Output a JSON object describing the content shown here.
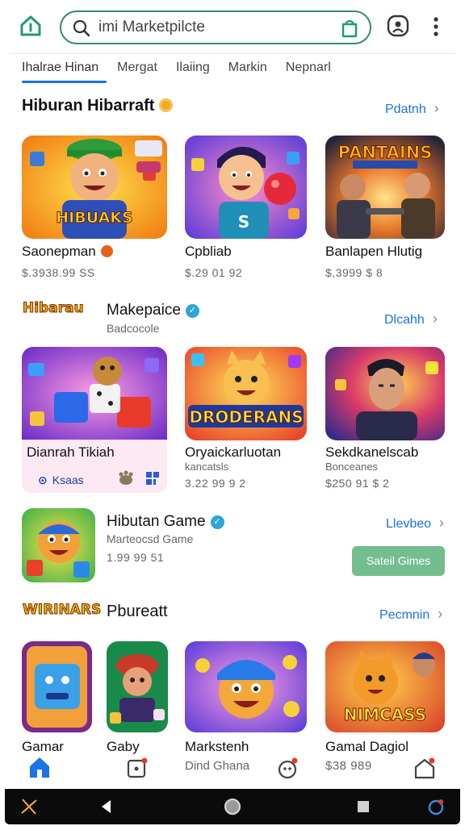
{
  "search": {
    "placeholder": "imi Marketpilcte"
  },
  "tabs": [
    {
      "label": "Ihalrae Hinan",
      "active": true
    },
    {
      "label": "Mergat",
      "active": false
    },
    {
      "label": "Ilaiing",
      "active": false
    },
    {
      "label": "Markin",
      "active": false
    },
    {
      "label": "Nepnarl",
      "active": false
    }
  ],
  "section1": {
    "title": "Hiburan Hibarraft",
    "see_all": "Pdatnh",
    "cards": [
      {
        "name": "Saonepman",
        "price": "$.3938.99 SS",
        "thumb_text": "HIBUAKS"
      },
      {
        "name": "Cpbliab",
        "price": "$.29 01 92"
      },
      {
        "name": "Banlapen Hlutig",
        "price": "$,3999 $ 8",
        "thumb_text": "PANTAINS"
      }
    ]
  },
  "section2": {
    "logo_text": "Hibarau",
    "title": "Makepaice",
    "subtitle": "Badcocole",
    "see_all": "Dlcahh",
    "cards": [
      {
        "name": "Dianrah Tikiah",
        "highlight_label": "Ksaas"
      },
      {
        "name": "Oryaickarluotan",
        "subtitle": "kancatsls",
        "price": "3.22 99 9 2",
        "thumb_text": "DRODERANS"
      },
      {
        "name": "Sekdkanelscab",
        "subtitle": "Bonceanes",
        "price": "$250 91 $ 2"
      }
    ]
  },
  "section3": {
    "title": "Hibutan Game",
    "subtitle": "Marteocsd Game",
    "price": "1.99 99 51",
    "see_all": "Llevbeo",
    "install": "Sateil Gimes"
  },
  "section4": {
    "logo_text": "WIRINARS",
    "title": "Pbureatt",
    "see_all": "Pecmnin",
    "cards": [
      {
        "name": "Gamar"
      },
      {
        "name": "Gaby"
      },
      {
        "name": "Markstenh",
        "subtitle": "Dind Ghana"
      },
      {
        "name": "Gamal Dagiol",
        "price": "$38 989",
        "thumb_text": "NIMCASS"
      }
    ]
  },
  "colors": {
    "accent": "#1a73e8",
    "search_border": "#2f8f6a",
    "install": "#74bd8e"
  },
  "icons": [
    "home-icon",
    "search-icon",
    "bag-icon",
    "profile-icon",
    "more-vert-icon",
    "chevron-right-icon",
    "verified-icon",
    "back-icon",
    "home-circle-icon",
    "recents-icon"
  ]
}
